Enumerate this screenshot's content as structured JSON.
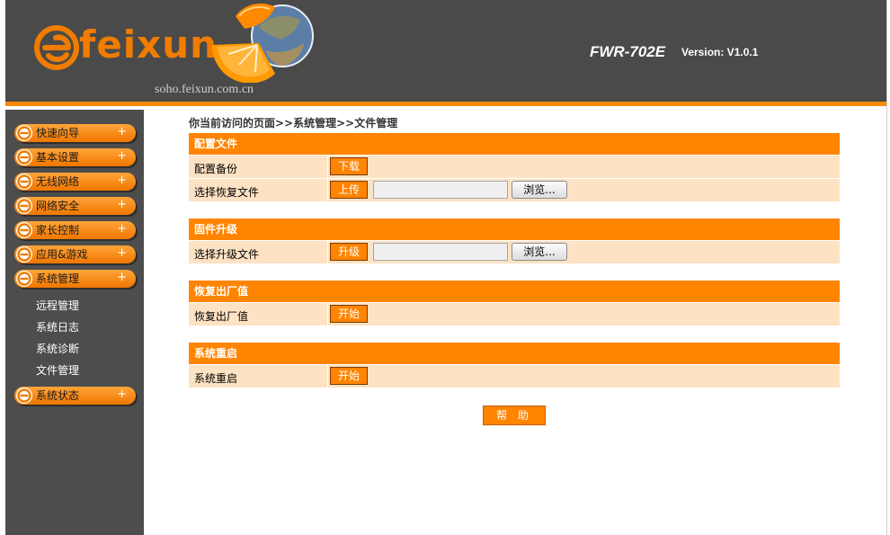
{
  "header": {
    "logo_text": "feixun",
    "site_url": "soho.feixun.com.cn",
    "model": "FWR-702E",
    "version": "Version: V1.0.1"
  },
  "sidebar": {
    "items": [
      {
        "label": "快速向导",
        "expand": "+"
      },
      {
        "label": "基本设置",
        "expand": "+"
      },
      {
        "label": "无线网络",
        "expand": "+"
      },
      {
        "label": "网络安全",
        "expand": "+"
      },
      {
        "label": "家长控制",
        "expand": "+"
      },
      {
        "label": "应用&游戏",
        "expand": "+"
      },
      {
        "label": "系统管理",
        "expand": "+"
      },
      {
        "label": "系统状态",
        "expand": "+"
      }
    ],
    "sub_items": [
      "远程管理",
      "系统日志",
      "系统诊断",
      "文件管理"
    ]
  },
  "breadcrumb": "你当前访问的页面>>系统管理>>文件管理",
  "sections": {
    "config": {
      "title": "配置文件",
      "backup_label": "配置备份",
      "backup_button": "下载",
      "restore_label": "选择恢复文件",
      "restore_button": "上传",
      "browse_button": "浏览..."
    },
    "firmware": {
      "title": "固件升级",
      "file_label": "选择升级文件",
      "upgrade_button": "升级",
      "browse_button": "浏览..."
    },
    "factory": {
      "title": "恢复出厂值",
      "label": "恢复出厂值",
      "button": "开始"
    },
    "reboot": {
      "title": "系统重启",
      "label": "系统重启",
      "button": "开始"
    }
  },
  "help_button": "帮 助",
  "colors": {
    "header_bg": "#4a4a4a",
    "accent": "#ff8400",
    "row_bg": "#fde2c3",
    "sidebar_bg": "#4d4d4d"
  }
}
